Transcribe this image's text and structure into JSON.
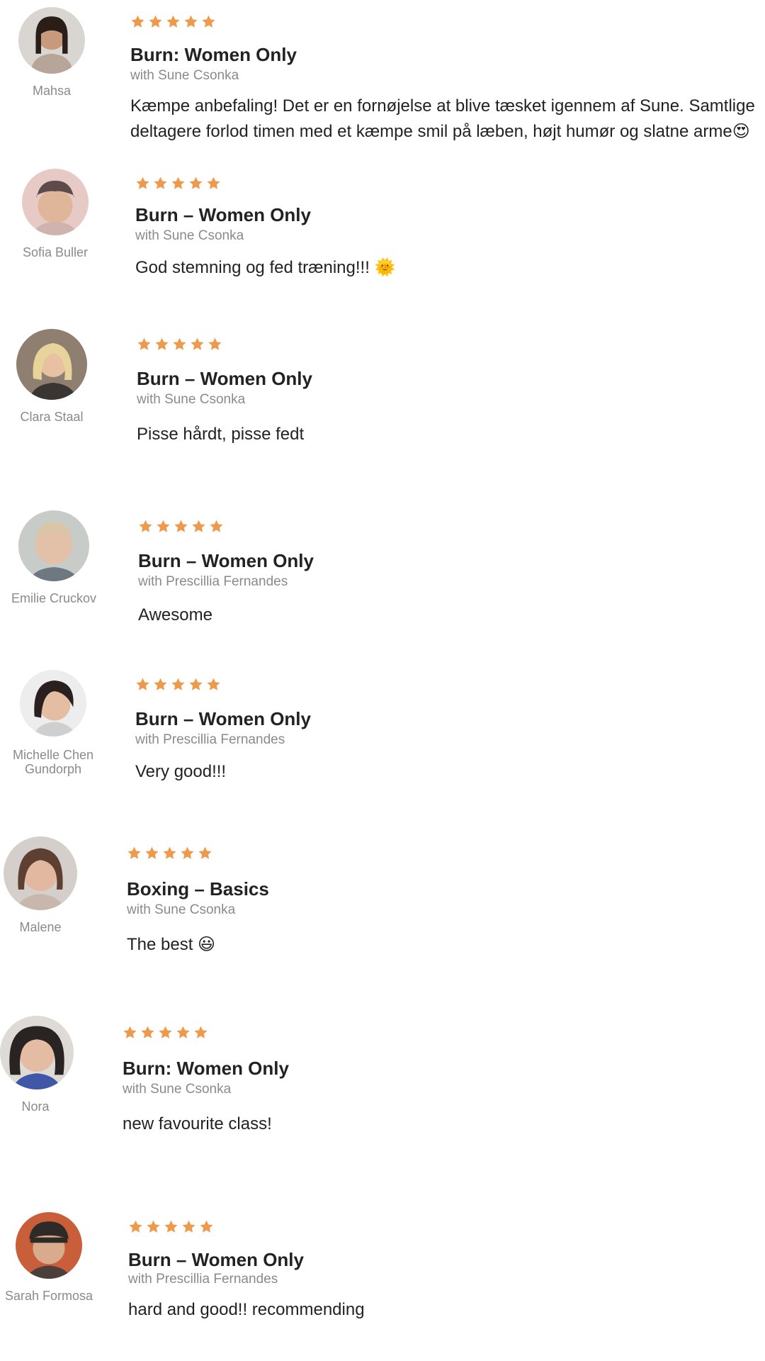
{
  "reviews": [
    {
      "reviewer": "Mahsa",
      "rating": 5,
      "class_title": "Burn: Women Only",
      "instructor": "with Sune Csonka",
      "comment": "Kæmpe anbefaling! Det er en fornøjelse at blive tæsket igennem af Sune. Samtlige deltagere forlod timen med et kæmpe smil på læben, højt humør og slatne arme😍"
    },
    {
      "reviewer": "Sofia Buller",
      "rating": 5,
      "class_title": "Burn – Women Only",
      "instructor": "with Sune Csonka",
      "comment": "God stemning og fed træning!!! 🌞"
    },
    {
      "reviewer": "Clara Staal",
      "rating": 5,
      "class_title": "Burn – Women Only",
      "instructor": "with Sune Csonka",
      "comment": "Pisse hårdt, pisse fedt"
    },
    {
      "reviewer": "Emilie Cruckov",
      "rating": 5,
      "class_title": "Burn – Women Only",
      "instructor": "with Prescillia Fernandes",
      "comment": "Awesome"
    },
    {
      "reviewer": "Michelle Chen Gundorph",
      "rating": 5,
      "class_title": "Burn – Women Only",
      "instructor": "with Prescillia Fernandes",
      "comment": "Very good!!!"
    },
    {
      "reviewer": "Malene",
      "rating": 5,
      "class_title": "Boxing – Basics",
      "instructor": "with Sune Csonka",
      "comment": "The best 😃"
    },
    {
      "reviewer": "Nora",
      "rating": 5,
      "class_title": "Burn: Women Only",
      "instructor": "with Sune Csonka",
      "comment": "new favourite class!"
    },
    {
      "reviewer": "Sarah Formosa",
      "rating": 5,
      "class_title": "Burn – Women Only",
      "instructor": "with Prescillia Fernandes",
      "comment": "hard and good!! recommending"
    }
  ],
  "colors": {
    "star": "#EE9A4D",
    "title": "#222222",
    "muted": "#8A8A8A"
  },
  "icons": {
    "star": "star-icon",
    "avatar": "avatar-photo"
  }
}
